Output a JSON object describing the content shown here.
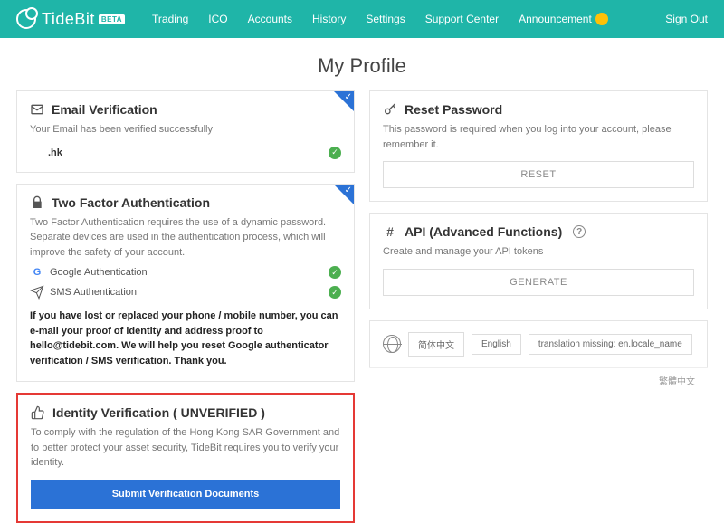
{
  "brand": {
    "name": "TideBit",
    "badge": "BETA"
  },
  "nav": {
    "items": [
      "Trading",
      "ICO",
      "Accounts",
      "History",
      "Settings",
      "Support Center",
      "Announcement"
    ],
    "signout": "Sign Out"
  },
  "page_title": "My Profile",
  "email_card": {
    "title": "Email Verification",
    "desc": "Your Email has been verified successfully",
    "value": ".hk"
  },
  "tfa_card": {
    "title": "Two Factor Authentication",
    "desc": "Two Factor Authentication requires the use of a dynamic password. Separate devices are used in the authentication process, which will improve the safety of your account.",
    "google": "Google Authentication",
    "sms": "SMS Authentication",
    "note": "If you have lost or replaced your phone / mobile number, you can e-mail your proof of identity and address proof to hello@tidebit.com. We will help you reset Google authenticator verification / SMS verification. Thank you."
  },
  "id_card": {
    "title": "Identity Verification ( UNVERIFIED )",
    "desc": "To comply with the regulation of the Hong Kong SAR Government and to better protect your asset security, TideBit requires you to verify your identity.",
    "button": "Submit Verification Documents"
  },
  "reset_card": {
    "title": "Reset Password",
    "desc": "This password is required when you log into your account, please remember it.",
    "button": "RESET"
  },
  "api_card": {
    "title": "API (Advanced Functions)",
    "desc": "Create and manage your API tokens",
    "button": "GENERATE"
  },
  "lang": {
    "opts": [
      "简体中文",
      "English",
      "translation missing: en.locale_name"
    ],
    "trad": "繁體中文"
  }
}
